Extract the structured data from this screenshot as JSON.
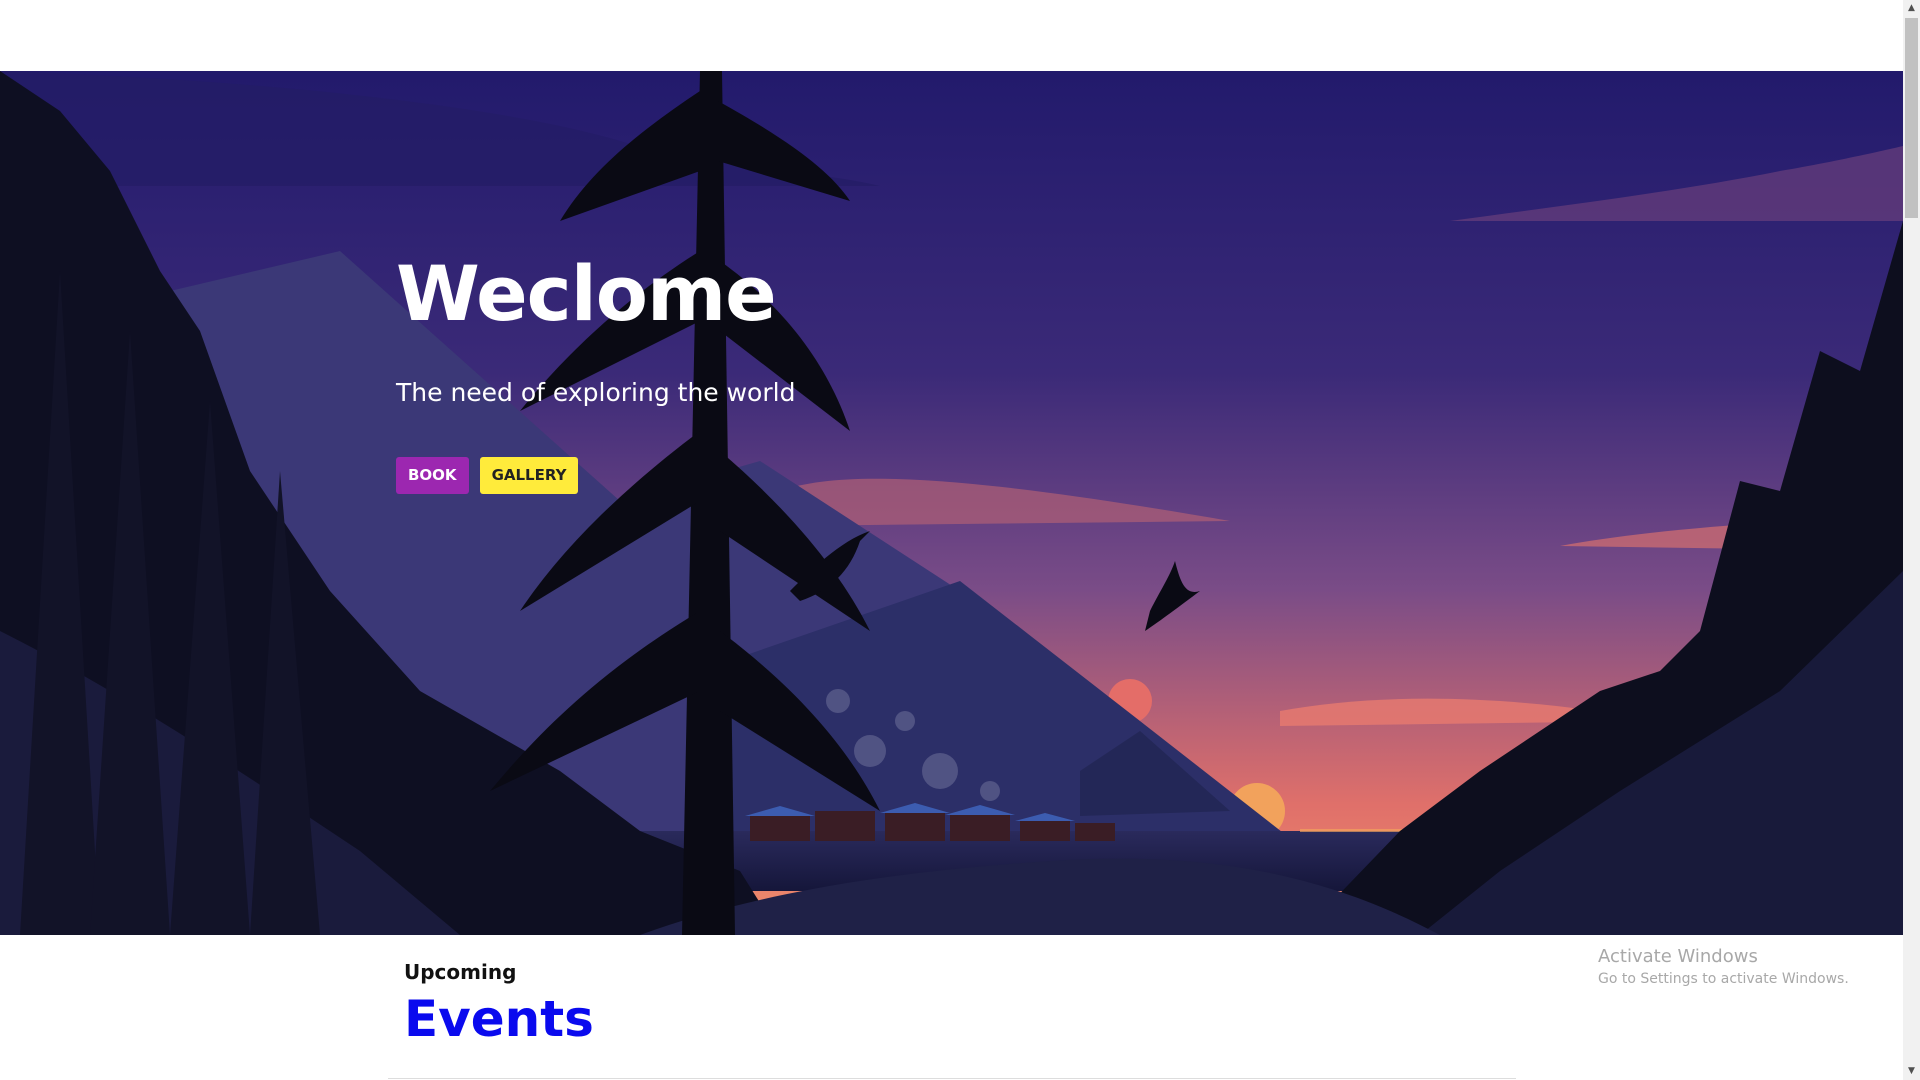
{
  "hero": {
    "title": "Weclome",
    "subtitle": "The need of exploring the world",
    "buttons": {
      "book": "BOOK",
      "gallery": "GALLERY"
    },
    "colors": {
      "sky_top": "#211a6b",
      "sky_mid": "#4a3680",
      "sky_glow": "#e06f6a",
      "mountain": "#2e3068",
      "forest": "#0c0c1a",
      "book_button": "#9c27b0",
      "gallery_button": "#ffeb3b"
    }
  },
  "events": {
    "kicker": "Upcoming",
    "title": "Events",
    "title_color": "#0a0aee"
  },
  "watermark": {
    "line1": "Activate Windows",
    "line2": "Go to Settings to activate Windows."
  },
  "icons": {
    "scroll_up": "scroll-up-arrow-icon",
    "scroll_down": "scroll-down-arrow-icon"
  }
}
